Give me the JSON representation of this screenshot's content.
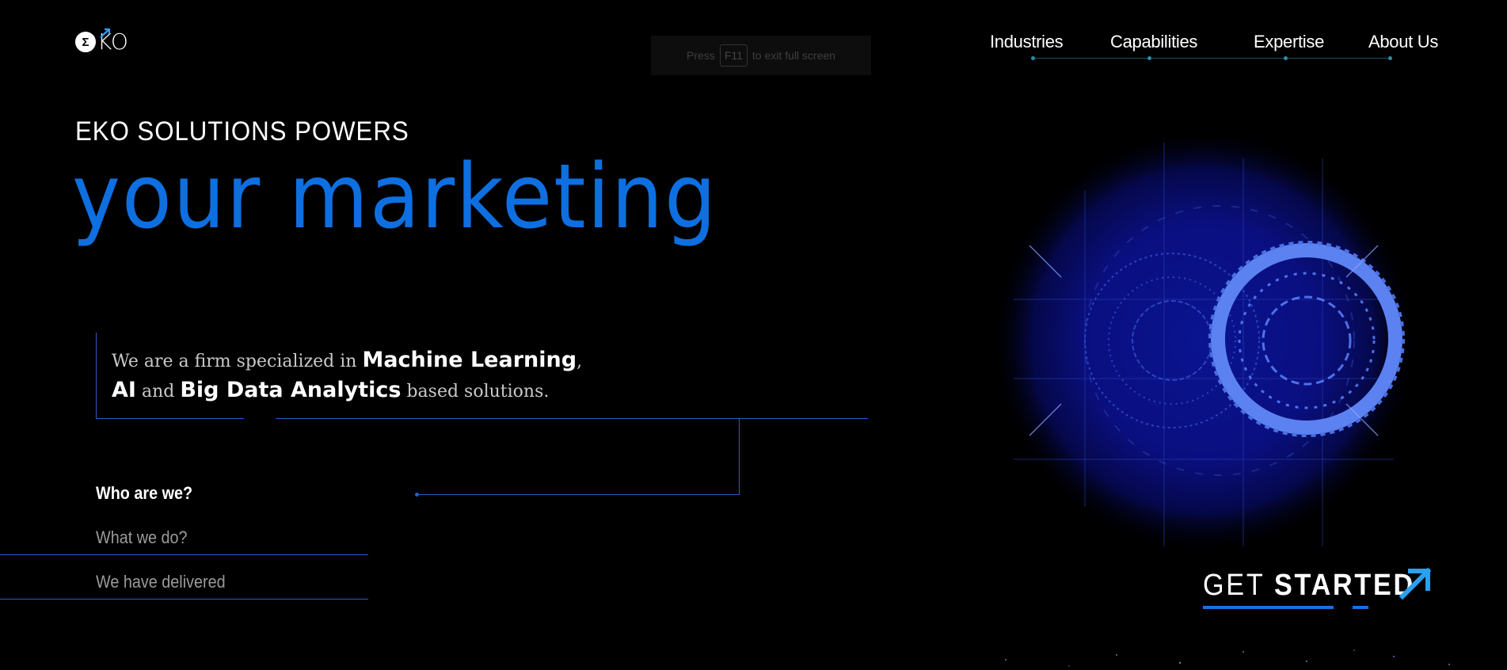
{
  "brand": {
    "logo_text": "KO",
    "logo_mark": "Σ"
  },
  "fullscreen_notice": {
    "press": "Press",
    "key": "F11",
    "suffix": "to exit full screen"
  },
  "nav": {
    "items": [
      {
        "label": "Industries"
      },
      {
        "label": "Capabilities"
      },
      {
        "label": "Expertise"
      },
      {
        "label": "About Us"
      }
    ]
  },
  "hero": {
    "eyebrow": "EKO SOLUTIONS POWERS",
    "headline": "your marketing"
  },
  "intro": {
    "part1": "We are a firm specialized in ",
    "ml": "Machine Learning",
    "comma": ",",
    "ai": "AI",
    "and": " and ",
    "bda": "Big Data Analytics",
    "suffix": " based solutions."
  },
  "side_menu": {
    "items": [
      {
        "label": "Who are we?",
        "active": true
      },
      {
        "label": "What we do?",
        "active": false
      },
      {
        "label": "We have delivered",
        "active": false
      }
    ]
  },
  "cta": {
    "light": "GET ",
    "bold": "STARTED"
  },
  "colors": {
    "accent": "#0e6fe0",
    "line": "#2a5bc8",
    "nav_line": "#1f4b5e",
    "arrow": "#2aa0f0"
  }
}
